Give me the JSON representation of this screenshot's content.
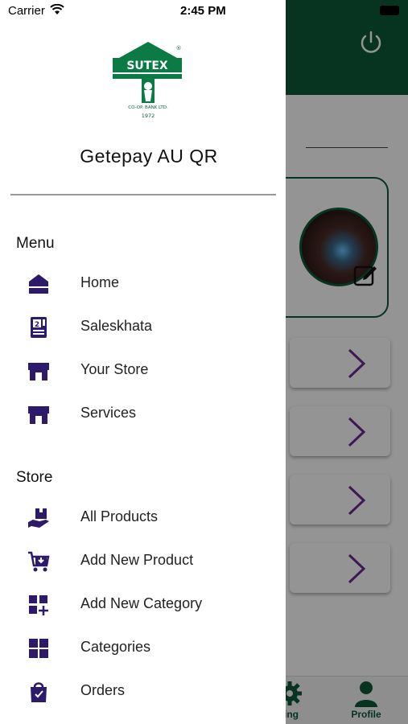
{
  "status_bar": {
    "carrier": "Carrier",
    "time": "2:45 PM"
  },
  "drawer": {
    "logo": {
      "text": "SUTEX",
      "sub": "CO-OP. BANK LTD.",
      "year": "1972",
      "mark": "®"
    },
    "title": "Getepay AU QR",
    "sections": [
      {
        "title": "Menu",
        "items": [
          {
            "label": "Home",
            "icon": "home-icon"
          },
          {
            "label": "Saleskhata",
            "icon": "ledger-icon"
          },
          {
            "label": "Your Store",
            "icon": "store-icon"
          },
          {
            "label": "Services",
            "icon": "store-icon"
          }
        ]
      },
      {
        "title": "Store",
        "items": [
          {
            "label": "All Products",
            "icon": "hand-box-icon"
          },
          {
            "label": "Add New Product",
            "icon": "cart-add-icon"
          },
          {
            "label": "Add New Category",
            "icon": "grid-add-icon"
          },
          {
            "label": "Categories",
            "icon": "grid-icon"
          },
          {
            "label": "Orders",
            "icon": "shopping-bag-icon"
          }
        ]
      }
    ]
  },
  "background_app": {
    "tabs": [
      {
        "label": "ting",
        "icon": "gear-icon"
      },
      {
        "label": "Profile",
        "icon": "person-icon"
      }
    ]
  },
  "colors": {
    "brand_green": "#0b5a3a",
    "icon_navy": "#2d1a6b",
    "arrow_purple": "#6a2c91"
  }
}
